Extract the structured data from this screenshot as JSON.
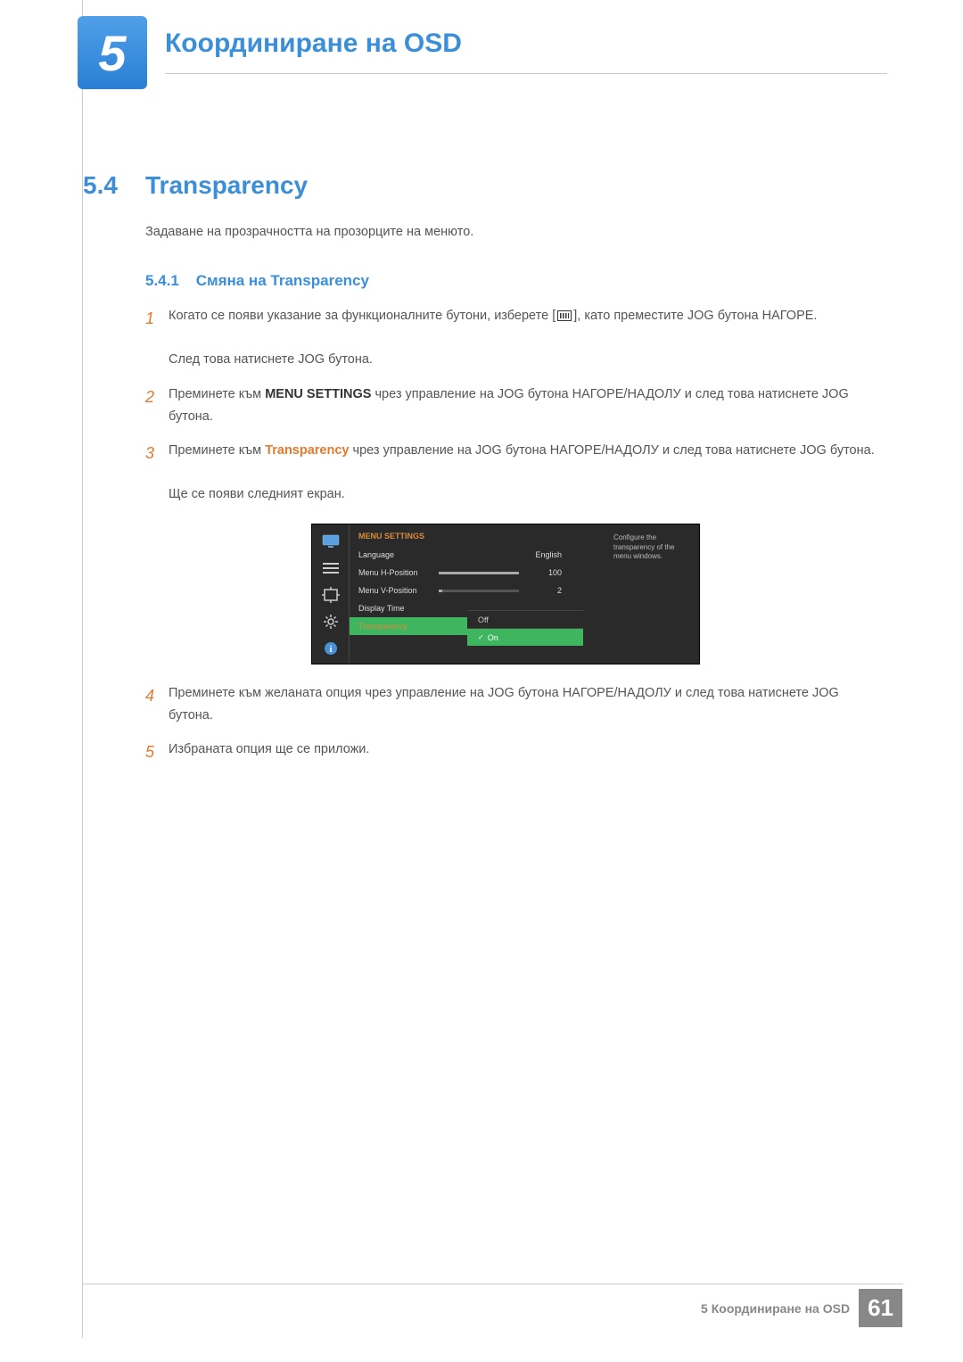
{
  "chapter": {
    "number": "5",
    "title": "Координиране на OSD"
  },
  "section": {
    "number": "5.4",
    "title": "Transparency",
    "description": "Задаване на прозрачността на прозорците на менюто."
  },
  "subsection": {
    "number": "5.4.1",
    "title": "Смяна на Transparency"
  },
  "steps": {
    "s1": {
      "num": "1",
      "pre": "Когато се появи указание за функционалните бутони, изберете [",
      "post": "], като преместите JOG бутона НАГОРЕ.",
      "line2": "След това натиснете JOG бутона."
    },
    "s2": {
      "num": "2",
      "pre": "Преминете към ",
      "bold": "MENU SETTINGS",
      "post": " чрез управление на JOG бутона НАГОРЕ/НАДОЛУ и след това натиснете JOG бутона."
    },
    "s3": {
      "num": "3",
      "pre": "Преминете към ",
      "orange": "Transparency",
      "post": " чрез управление на JOG бутона НАГОРЕ/НАДОЛУ и след това натиснете JOG бутона.",
      "line2": "Ще се появи следният екран."
    },
    "s4": {
      "num": "4",
      "text": "Преминете към желаната опция чрез управление на JOG бутона НАГОРЕ/НАДОЛУ и след това натиснете JOG бутона."
    },
    "s5": {
      "num": "5",
      "text": "Избраната опция ще се приложи."
    }
  },
  "osd": {
    "title": "MENU SETTINGS",
    "rows": {
      "language": {
        "label": "Language",
        "value": "English"
      },
      "hpos": {
        "label": "Menu H-Position",
        "value": "100"
      },
      "vpos": {
        "label": "Menu V-Position",
        "value": "2"
      },
      "display_time": {
        "label": "Display Time"
      },
      "transparency": {
        "label": "Transparency"
      }
    },
    "options": {
      "off": "Off",
      "on": "On"
    },
    "help": "Configure the transparency of the menu windows."
  },
  "footer": {
    "text": "5 Координиране на OSD",
    "page": "61"
  }
}
